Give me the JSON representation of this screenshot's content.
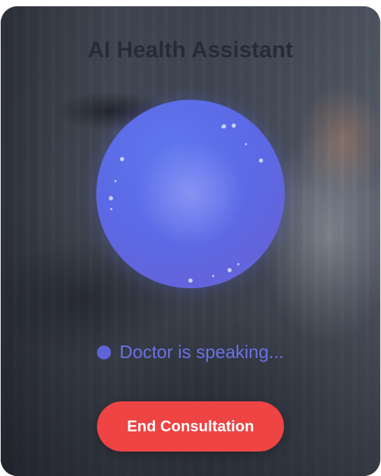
{
  "header": {
    "title": "AI Health Assistant"
  },
  "status": {
    "text": "Doctor is speaking...",
    "indicator_color": "#5c64d6"
  },
  "actions": {
    "end_label": "End Consultation",
    "end_color": "#ef4444"
  },
  "orb": {
    "color": "#5b6ae6"
  }
}
